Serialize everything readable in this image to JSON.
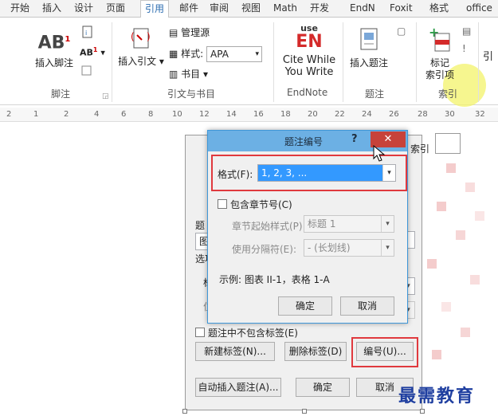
{
  "tabs": [
    "开始",
    "插入",
    "设计",
    "页面",
    "引用",
    "邮件",
    "审阅",
    "视图",
    "Math",
    "开发",
    "EndN",
    "Foxit",
    "格式",
    "office"
  ],
  "ribbon": {
    "footnote": {
      "insert_label": "插入脚注",
      "ab_label": "AB",
      "ab_small": "AB",
      "group_label": "脚注"
    },
    "citation": {
      "insert_label": "插入引文",
      "manage_label": "管理源",
      "style_label": "样式:",
      "style_value": "APA",
      "bib_label": "书目",
      "group_label": "引文与书目"
    },
    "endnote": {
      "logo_small": "use",
      "logo_big": "EN",
      "label_line1": "Cite While",
      "label_line2": "You Write",
      "group_label": "EndNote"
    },
    "caption": {
      "insert_label": "插入题注",
      "group_label": "题注"
    },
    "index": {
      "mark_line1": "标记",
      "mark_line2": "索引项",
      "group_label": "索引"
    },
    "toa_label": "引"
  },
  "ruler": [
    "2",
    "1",
    "2",
    "4",
    "6",
    "8",
    "10",
    "12",
    "14",
    "16",
    "18",
    "20",
    "22",
    "24",
    "26",
    "28",
    "30",
    "32"
  ],
  "outer_dialog": {
    "fragments": [
      "题",
      "图",
      "选项",
      "标",
      "位",
      "索引"
    ],
    "exclude_label": "题注中不包含标签(E)",
    "new_label": "新建标签(N)...",
    "delete_label": "删除标签(D)",
    "numbering": "编号(U)...",
    "autoinsert": "自动插入题注(A)...",
    "ok": "确定",
    "cancel": "取消"
  },
  "inner_dialog": {
    "title": "题注编号",
    "help": "?",
    "close": "✕",
    "format_label": "格式(F):",
    "format_value": "1, 2, 3, ...",
    "include_chapter": "包含章节号(C)",
    "chapter_style_label": "章节起始样式(P)",
    "chapter_style_value": "标题 1",
    "separator_label": "使用分隔符(E):",
    "separator_value": "- (长划线)",
    "example": "示例: 图表 II-1，表格 1-A",
    "ok": "确定",
    "cancel": "取消"
  },
  "watermark": "最需教育",
  "colors": {
    "accent": "#2b6cb0",
    "close_red": "#c7423a",
    "highlight_red": "#e0393e",
    "titlebar": "#6cb0e4",
    "selection": "#3399ff"
  }
}
